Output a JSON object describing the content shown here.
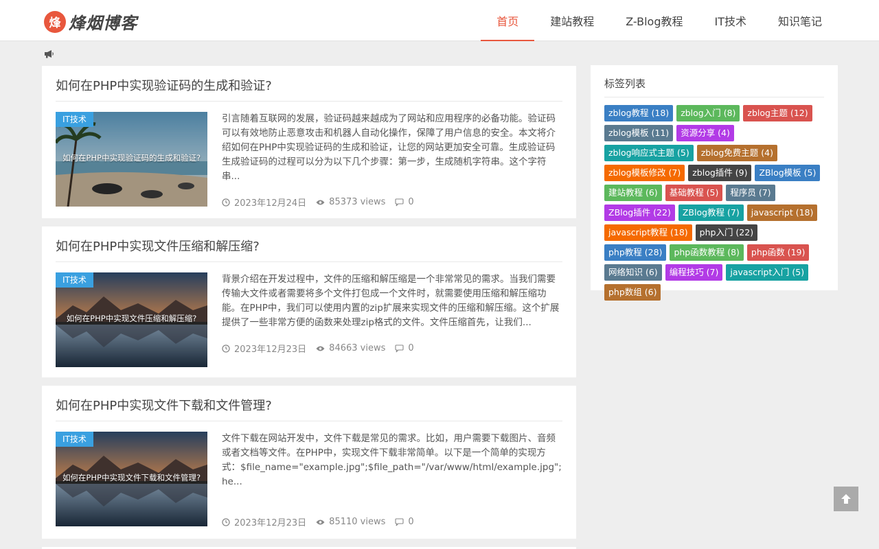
{
  "brand": {
    "logo_char": "烽",
    "name": "烽烟博客"
  },
  "nav": [
    {
      "label": "首页",
      "active": true
    },
    {
      "label": "建站教程"
    },
    {
      "label": "Z-Blog教程"
    },
    {
      "label": "IT技术"
    },
    {
      "label": "知识笔记"
    }
  ],
  "posts": [
    {
      "title": "如何在PHP中实现验证码的生成和验证?",
      "category": "IT技术",
      "thumb_caption": "如何在PHP中实现验证码的生成和验证?",
      "excerpt": "引言随着互联网的发展，验证码越来越成为了网站和应用程序的必备功能。验证码可以有效地防止恶意攻击和机器人自动化操作，保障了用户信息的安全。本文将介绍如何在PHP中实现验证码的生成和验证，让您的网站更加安全可靠。生成验证码生成验证码的过程可以分为以下几个步骤：第一步，生成随机字符串。这个字符串...",
      "date": "2023年12月24日",
      "views": "85373 views",
      "comments": "0"
    },
    {
      "title": "如何在PHP中实现文件压缩和解压缩?",
      "category": "IT技术",
      "thumb_caption": "如何在PHP中实现文件压缩和解压缩?",
      "excerpt": "背景介绍在开发过程中，文件的压缩和解压缩是一个非常常见的需求。当我们需要传输大文件或者需要将多个文件打包成一个文件时，就需要使用压缩和解压缩功能。在PHP中，我们可以使用内置的zip扩展来实现文件的压缩和解压缩。这个扩展提供了一些非常方便的函数来处理zip格式的文件。文件压缩首先，让我们...",
      "date": "2023年12月23日",
      "views": "84663 views",
      "comments": "0"
    },
    {
      "title": "如何在PHP中实现文件下载和文件管理?",
      "category": "IT技术",
      "thumb_caption": "如何在PHP中实现文件下载和文件管理?",
      "excerpt": "文件下载在网站开发中，文件下载是常见的需求。比如，用户需要下载图片、音频或者文档等文件。在PHP中，实现文件下载非常简单。以下是一个简单的实现方式：$file_name=\"example.jpg\";$file_path=\"/var/www/html/example.jpg\";he...",
      "date": "2023年12月23日",
      "views": "85110 views",
      "comments": "0"
    }
  ],
  "sidebar": {
    "title": "标签列表",
    "tags": [
      {
        "label": "zblog教程 (18)",
        "color": "#3a7fc4"
      },
      {
        "label": "zblog入门 (8)",
        "color": "#5cb85c"
      },
      {
        "label": "zblog主题 (12)",
        "color": "#d9534f"
      },
      {
        "label": "zblog模板 (11)",
        "color": "#5a7a90"
      },
      {
        "label": "资源分享 (4)",
        "color": "#b23be6"
      },
      {
        "label": "zblog响应式主题 (5)",
        "color": "#17a2a2"
      },
      {
        "label": "zblog免费主题 (4)",
        "color": "#b5702e"
      },
      {
        "label": "zblog模板修改 (7)",
        "color": "#f56a00"
      },
      {
        "label": "zblog插件 (9)",
        "color": "#444444"
      },
      {
        "label": "ZBlog模板 (5)",
        "color": "#3a7fc4"
      },
      {
        "label": "建站教程 (6)",
        "color": "#5cb85c"
      },
      {
        "label": "基础教程 (5)",
        "color": "#d9534f"
      },
      {
        "label": "程序员 (7)",
        "color": "#5a7a90"
      },
      {
        "label": "ZBlog插件 (22)",
        "color": "#b23be6"
      },
      {
        "label": "ZBlog教程 (7)",
        "color": "#17a2a2"
      },
      {
        "label": "javascript (18)",
        "color": "#b5702e"
      },
      {
        "label": "javascript教程 (18)",
        "color": "#f56a00"
      },
      {
        "label": "php入门 (22)",
        "color": "#444444"
      },
      {
        "label": "php教程 (28)",
        "color": "#3a7fc4"
      },
      {
        "label": "php函数教程 (8)",
        "color": "#5cb85c"
      },
      {
        "label": "php函数 (19)",
        "color": "#d9534f"
      },
      {
        "label": "网络知识 (6)",
        "color": "#5a7a90"
      },
      {
        "label": "编程技巧 (7)",
        "color": "#b23be6"
      },
      {
        "label": "javascript入门 (5)",
        "color": "#17a2a2"
      },
      {
        "label": "php数组 (6)",
        "color": "#b5702e"
      }
    ]
  },
  "icons": {
    "notice": "megaphone-icon",
    "date": "clock-icon",
    "views": "eye-icon",
    "comments": "comment-icon",
    "totop": "arrow-up-icon"
  },
  "colors": {
    "accent": "#e8573d",
    "category_badge": "#3aa0e0"
  }
}
